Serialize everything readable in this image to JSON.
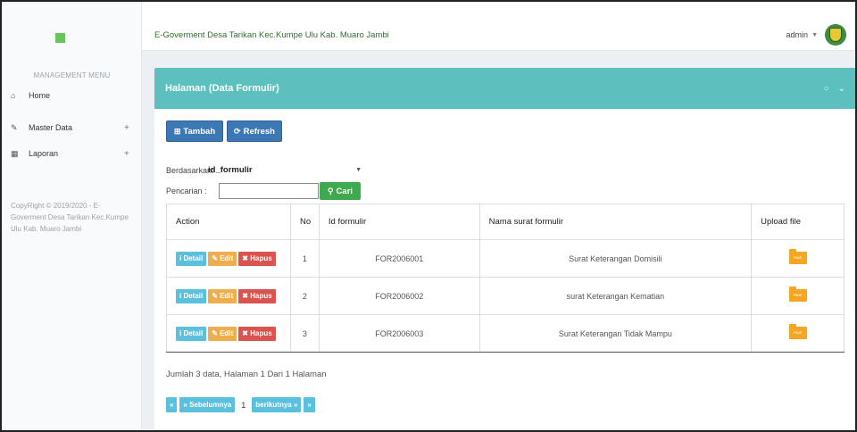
{
  "sidebar": {
    "menu_header": "MANAGEMENT MENU",
    "items": [
      {
        "label": "Home",
        "icon": "home-icon",
        "expandable": false
      },
      {
        "label": "Master Data",
        "icon": "edit-icon",
        "expandable": true
      },
      {
        "label": "Laporan",
        "icon": "calendar-icon",
        "expandable": true
      }
    ],
    "plus": "+",
    "copyright": "CopyRight © 2019/2020 - E-Goverment Desa Tarikan Kec.Kumpe Ulu Kab. Muaro Jambi"
  },
  "header": {
    "title": "E-Goverment Desa Tarikan Kec.Kumpe Ulu Kab. Muaro Jambi",
    "user": "admin"
  },
  "panel": {
    "title": "Halaman (Data Formulir)",
    "tambah_label": "Tambah",
    "refresh_label": "Refresh",
    "filter_label": "Berdasarkan:",
    "filter_value": "id_formulir",
    "search_label": "Pencarian   :",
    "search_value": "",
    "cari_label": "Cari"
  },
  "table": {
    "headers": [
      "Action",
      "No",
      "Id formulir",
      "Nama surat formulir",
      "Upload file"
    ],
    "action_labels": {
      "detail": "Detail",
      "edit": "Edit",
      "hapus": "Hapus"
    },
    "file_label": "FILE",
    "rows": [
      {
        "no": "1",
        "id": "FOR2006001",
        "nama": "Surat Keterangan Domisili"
      },
      {
        "no": "2",
        "id": "FOR2006002",
        "nama": "surat Keterangan Kematian"
      },
      {
        "no": "3",
        "id": "FOR2006003",
        "nama": "Surat Keterangan Tidak Mampu"
      }
    ]
  },
  "summary": "Jumlah 3 data, Halaman 1 Dari 1 Halaman",
  "pager": {
    "first": "«",
    "prev": "« Sebelumnya",
    "current": "1",
    "next": "berikutnya »",
    "last": "»"
  },
  "colors": {
    "panel_header": "#5bc0be",
    "primary": "#3c78b4",
    "success": "#3fa94d",
    "info": "#5bc0de",
    "warning": "#f0ad4e",
    "danger": "#d9534f"
  }
}
